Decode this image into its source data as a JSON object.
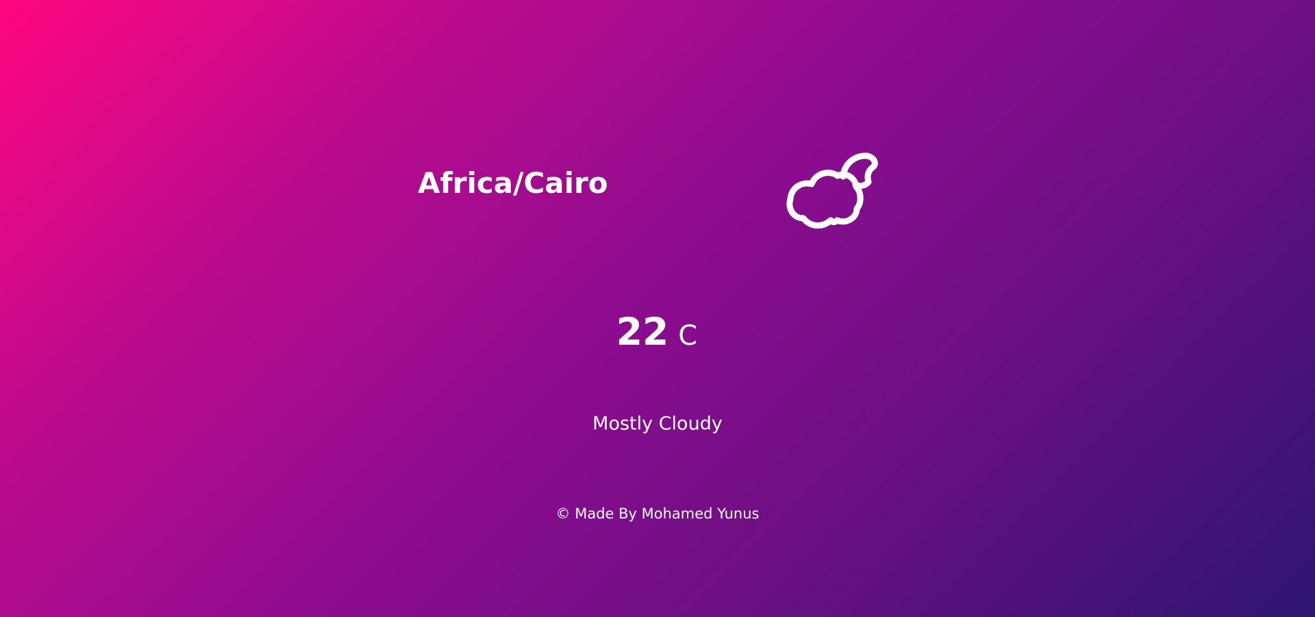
{
  "location": {
    "timezone": "Africa/Cairo"
  },
  "weather": {
    "icon": "partly-cloudy-night-icon",
    "temperature": "22",
    "unit": "C",
    "description": "Mostly Cloudy"
  },
  "footer": {
    "text": "© Made By Mohamed Yunus"
  },
  "colors": {
    "text": "#ffffff",
    "gradient_start": "#ff077f",
    "gradient_mid": "#8e0c8f",
    "gradient_end": "#2d1570"
  }
}
